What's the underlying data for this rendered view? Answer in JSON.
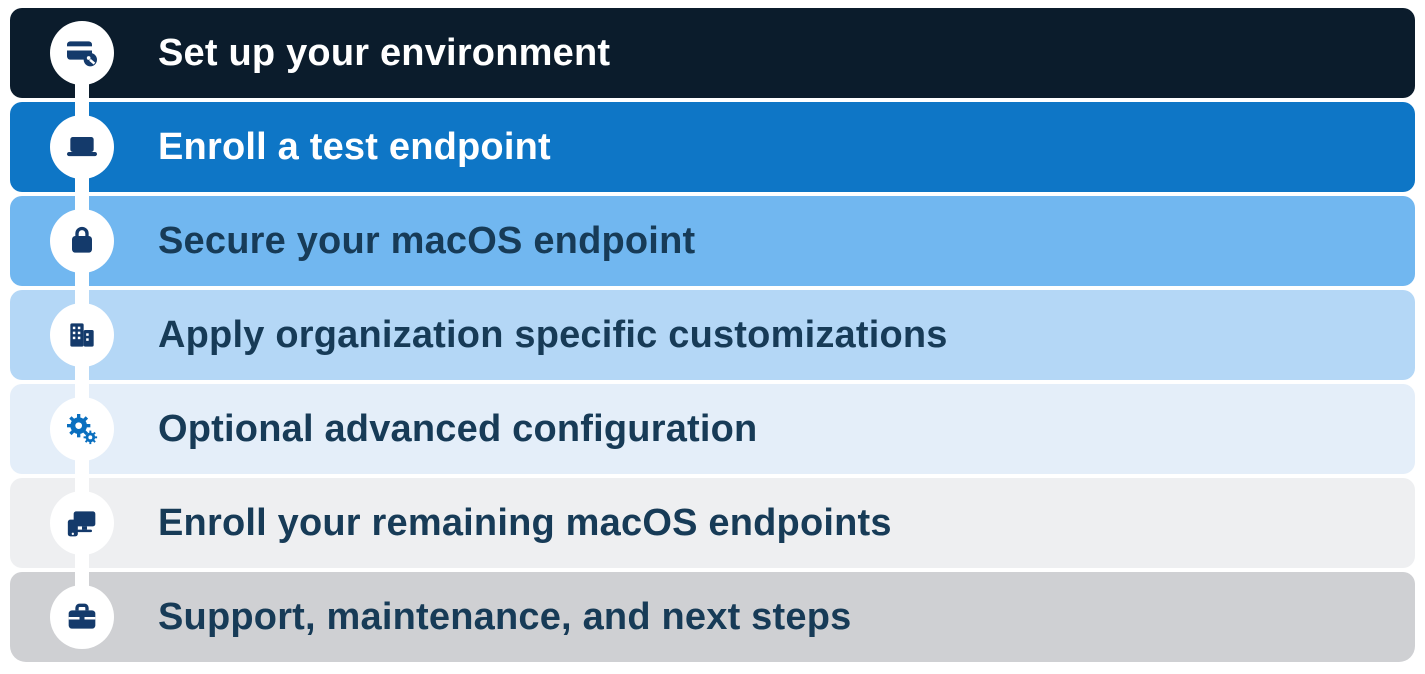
{
  "steps": [
    {
      "label": "Set up your environment",
      "icon": "card-key-icon",
      "bg": "#0b1c2c",
      "fg": "#ffffff",
      "iconColor": "#143a6b"
    },
    {
      "label": "Enroll a test endpoint",
      "icon": "laptop-icon",
      "bg": "#0e76c6",
      "fg": "#ffffff",
      "iconColor": "#143a6b"
    },
    {
      "label": "Secure your macOS endpoint",
      "icon": "lock-icon",
      "bg": "#71b7f0",
      "fg": "#173b57",
      "iconColor": "#143a6b"
    },
    {
      "label": "Apply organization specific customizations",
      "icon": "building-icon",
      "bg": "#b4d7f6",
      "fg": "#173b57",
      "iconColor": "#143a6b"
    },
    {
      "label": "Optional advanced configuration",
      "icon": "gears-icon",
      "bg": "#e4eef9",
      "fg": "#173b57",
      "iconColor": "#0a6fbf"
    },
    {
      "label": "Enroll your remaining macOS endpoints",
      "icon": "devices-icon",
      "bg": "#eeeff1",
      "fg": "#173b57",
      "iconColor": "#143a6b"
    },
    {
      "label": "Support, maintenance, and next steps",
      "icon": "briefcase-icon",
      "bg": "#cfd0d3",
      "fg": "#173b57",
      "iconColor": "#143a6b"
    }
  ]
}
